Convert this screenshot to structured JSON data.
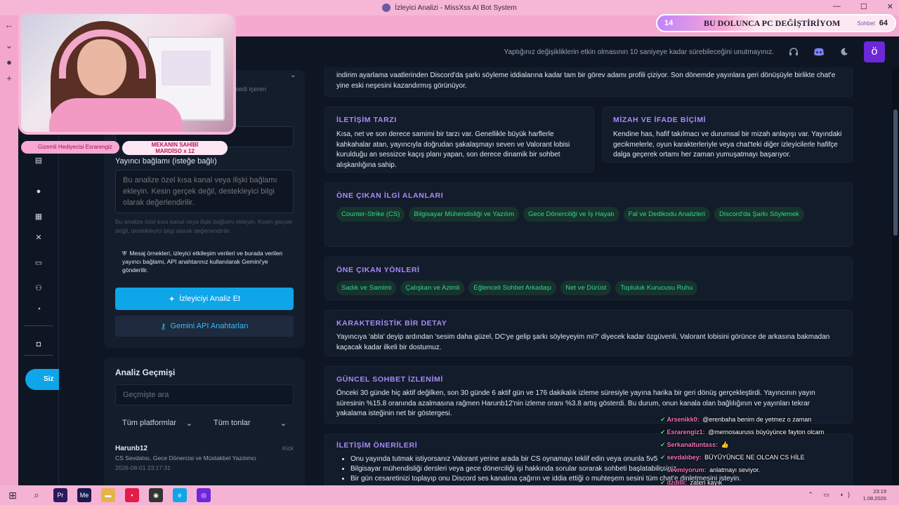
{
  "window": {
    "title": "İzleyici Analizi - MissXss AI Bot System"
  },
  "topbar": {
    "notice": "Yaptığınız değişikliklerin etkin olmasının 10 saniyeye kadar sürebileceğini unutmayınız.",
    "avatar_letter": "ö",
    "icons": [
      "headset-icon",
      "discord-icon",
      "moon-icon"
    ]
  },
  "rail": {
    "items": [
      "calendar-icon",
      "chat-bubble-icon",
      "calendar-icon",
      "tools-icon",
      "id-card-icon",
      "users-icon",
      "support-icon",
      "gamepad-icon"
    ],
    "pill_label": "Siz"
  },
  "form": {
    "hint_top": "f komedi içeren",
    "name_placeholder": "irkç",
    "context_label": "Yayıncı bağlamı (isteğe bağlı)",
    "context_placeholder": "Bu analize özel kısa kanal veya ilişki bağlamı ekleyin. Kesin gerçek değil, destekleyici bilgi olarak değerlendirilir.",
    "context_help": "Bu analize özel kısa kanal veya ilişki bağlamı ekleyin. Kesin gerçek değil, destekleyici bilgi olarak değerlendirilir.",
    "privacy_note": "Mesaj örnekleri, izleyici etkileşim verileri ve burada verilen yayıncı bağlamı, API anahtarınız kullanılarak Gemini'ye gönderilir.",
    "analyze_button": "İzleyiciyi Analiz Et",
    "api_keys_button": "Gemini API Anahtarları"
  },
  "history": {
    "title": "Analiz Geçmişi",
    "search_placeholder": "Geçmişte ara",
    "filter_platform": "Tüm platformlar",
    "filter_tone": "Tüm tonlar",
    "entries": [
      {
        "name": "Harunb12",
        "platform": "Kick",
        "desc": "CS Sevdalısı, Gece Dönercisi ve Müstakbel Yazılımcı",
        "date": "2026-08-01 23:17:31"
      }
    ]
  },
  "main": {
    "intro": "indirim ayarlama vaatlerinden Discord'da şarkı söyleme iddialarına kadar tam bir görev adamı profili çiziyor. Son dönemde yayınlara geri dönüşüyle birlikte chat'e yine eski neşesini kazandırmış görünüyor.",
    "comm_style": {
      "title": "İLETİŞİM TARZI",
      "text": "Kısa, net ve son derece samimi bir tarzı var. Genellikle büyük harflerle kahkahalar atan, yayıncıyla doğrudan şakalaşmayı seven ve Valorant lobisi kurulduğu an sessizce kaçış planı yapan, son derece dinamik bir sohbet alışkanlığına sahip."
    },
    "humor": {
      "title": "MİZAH VE İFADE BİÇİMİ",
      "text": "Kendine has, hafif takılmacı ve durumsal bir mizah anlayışı var. Yayındaki gecikmelerle, oyun karakterleriyle veya chat'teki diğer izleyicilerle hafifçe dalga geçerek ortamı her zaman yumuşatmayı başarıyor."
    },
    "interests": {
      "title": "ÖNE ÇIKAN İLGİ ALANLARI",
      "tags": [
        "Counter-Strike (CS)",
        "Bilgisayar Mühendisliği ve Yazılım",
        "Gece Dönerciliği ve İş Hayatı",
        "Fal ve Dedikodu Analizleri",
        "Discord'da Şarkı Söylemek"
      ]
    },
    "traits": {
      "title": "ÖNE ÇIKAN YÖNLERİ",
      "tags": [
        "Sadık ve Samimi",
        "Çalışkan ve Azimli",
        "Eğlenceli Sohbet Arkadaşı",
        "Net ve Dürüst",
        "Topluluk Kurucusu Ruhu"
      ]
    },
    "detail": {
      "title": "KARAKTERİSTİK BİR DETAY",
      "text": "Yayıncıya 'abla' deyip ardından 'sesim daha güzel, DC'ye gelip şarkı söyleyeyim mi?' diyecek kadar özgüvenli, Valorant lobisini görünce de arkasına bakmadan kaçacak kadar ilkeli bir dostumuz."
    },
    "impression": {
      "title": "GÜNCEL SOHBET İZLENİMİ",
      "text": "Önceki 30 günde hiç aktif değilken, son 30 günde 6 aktif gün ve 176 dakikalık izleme süresiyle yayına harika bir geri dönüş gerçekleştirdi. Yayıncının yayın süresinin %15.8 oranında azalmasına rağmen Harunb12'nin izleme oranı %3.8 artış gösterdi. Bu durum, onun kanala olan bağlılığının ve yayınları tekrar yakalama isteğinin net bir göstergesi."
    },
    "suggestions": {
      "title": "İLETİŞİM ÖNERİLERİ",
      "items": [
        "Onu yayında tutmak istiyorsanız Valorant yerine arada bir CS oynamayı teklif edin veya onunla 5v5",
        "Bilgisayar mühendisliği dersleri veya gece dönerciliği işi hakkında sorular sorarak sohbeti başlatabilirsiniz,",
        "Bir gün cesaretinizi toplayıp onu Discord ses kanalına çağırın ve iddia ettiği o muhteşem sesini tüm chat'e dinletmesini isteyin."
      ]
    }
  },
  "overlay": {
    "badge_left": "Gizemli Hediyecisi Esrarengiz",
    "badge_right_title": "MEKANIN SAHİBİ",
    "badge_right_name": "MARDİSO x 12",
    "goal_min": "14",
    "goal_text": "BU DOLUNCA PC DEĞİŞTİRİYOM",
    "goal_label": "Sohbet",
    "goal_max": "64",
    "chat": [
      {
        "user": "Arsenikk0:",
        "text": "@erenbaha benim de yetmez o zaman"
      },
      {
        "user": "Esrarengiz1:",
        "text": "@memosauruss büyüyünce fayton olcam"
      },
      {
        "user": "Serkanaltuntass:",
        "text": "👍"
      },
      {
        "user": "sevdalıbey:",
        "text": "BÜYÜYÜNCE NE OLCAN CS HİLE"
      },
      {
        "user": "sevmiyorum:",
        "text": "anlatmayı seviyor."
      },
      {
        "user": "dzdilli:",
        "text": "zaten kayık"
      }
    ]
  },
  "taskbar": {
    "time": "23:19",
    "date": "1.08.2026"
  }
}
